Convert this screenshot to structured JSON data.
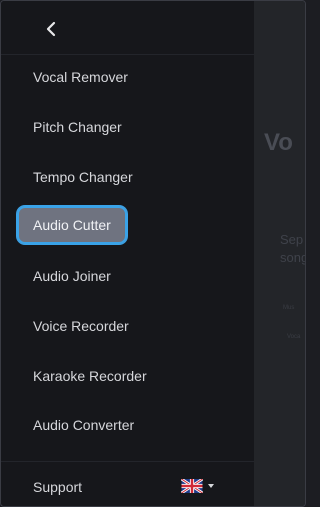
{
  "nav": {
    "back_icon": "chevron-left-icon",
    "items": [
      {
        "label": "Vocal Remover"
      },
      {
        "label": "Pitch Changer"
      },
      {
        "label": "Tempo Changer"
      },
      {
        "label": "Audio Cutter",
        "active": true
      },
      {
        "label": "Audio Joiner"
      },
      {
        "label": "Voice Recorder"
      },
      {
        "label": "Karaoke Recorder"
      },
      {
        "label": "Audio Converter"
      }
    ],
    "support_label": "Support",
    "language_icon": "uk-flag-icon"
  },
  "main": {
    "title_fragment": "Vo",
    "subtitle_line1": "Sep",
    "subtitle_line2": "song",
    "small_text1": "Mus",
    "small_text2": "Voca"
  },
  "colors": {
    "sidebar_bg": "#16171b",
    "main_bg": "#232529",
    "active_item_bg": "#6f7380",
    "active_outline": "#3aa3e8"
  }
}
